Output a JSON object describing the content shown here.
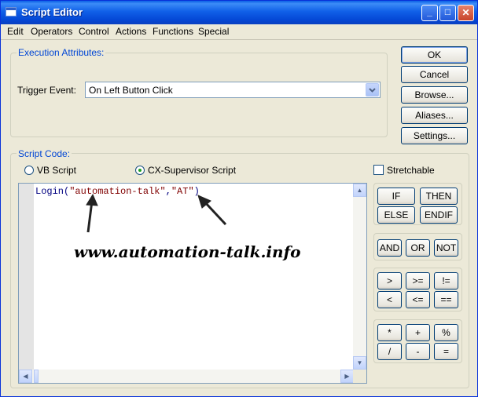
{
  "window": {
    "title": "Script Editor"
  },
  "title_buttons": {
    "minimize": "_",
    "maximize": "□",
    "close": "✕"
  },
  "menu": [
    "Edit",
    "Operators",
    "Control",
    "Actions",
    "Functions",
    "Special"
  ],
  "execution": {
    "legend": "Execution Attributes:",
    "trigger_label": "Trigger Event:",
    "trigger_value": "On Left Button Click"
  },
  "buttons": [
    "OK",
    "Cancel",
    "Browse...",
    "Aliases...",
    "Settings..."
  ],
  "script_code": {
    "legend": "Script Code:",
    "vb_label": "VB Script",
    "cx_label": "CX-Supervisor Script",
    "stretchable_label": "Stretchable",
    "code_func": "Login(",
    "code_arg1": "\"automation-talk\"",
    "code_comma": ",",
    "code_arg2": "\"AT\"",
    "code_close": ")",
    "watermark": "www.automation-talk.info"
  },
  "operators": {
    "control": [
      "IF",
      "THEN",
      "ELSE",
      "ENDIF"
    ],
    "logic": [
      "AND",
      "OR",
      "NOT"
    ],
    "compare": [
      ">",
      ">=",
      "!=",
      "<",
      "<=",
      "=="
    ],
    "math": [
      "*",
      "+",
      "%",
      "/",
      "-",
      "="
    ]
  },
  "colors": {
    "title_bar": "#0a5fe6",
    "code_text": "#000080",
    "string_text": "#800000",
    "legend_text": "#0046d5"
  }
}
